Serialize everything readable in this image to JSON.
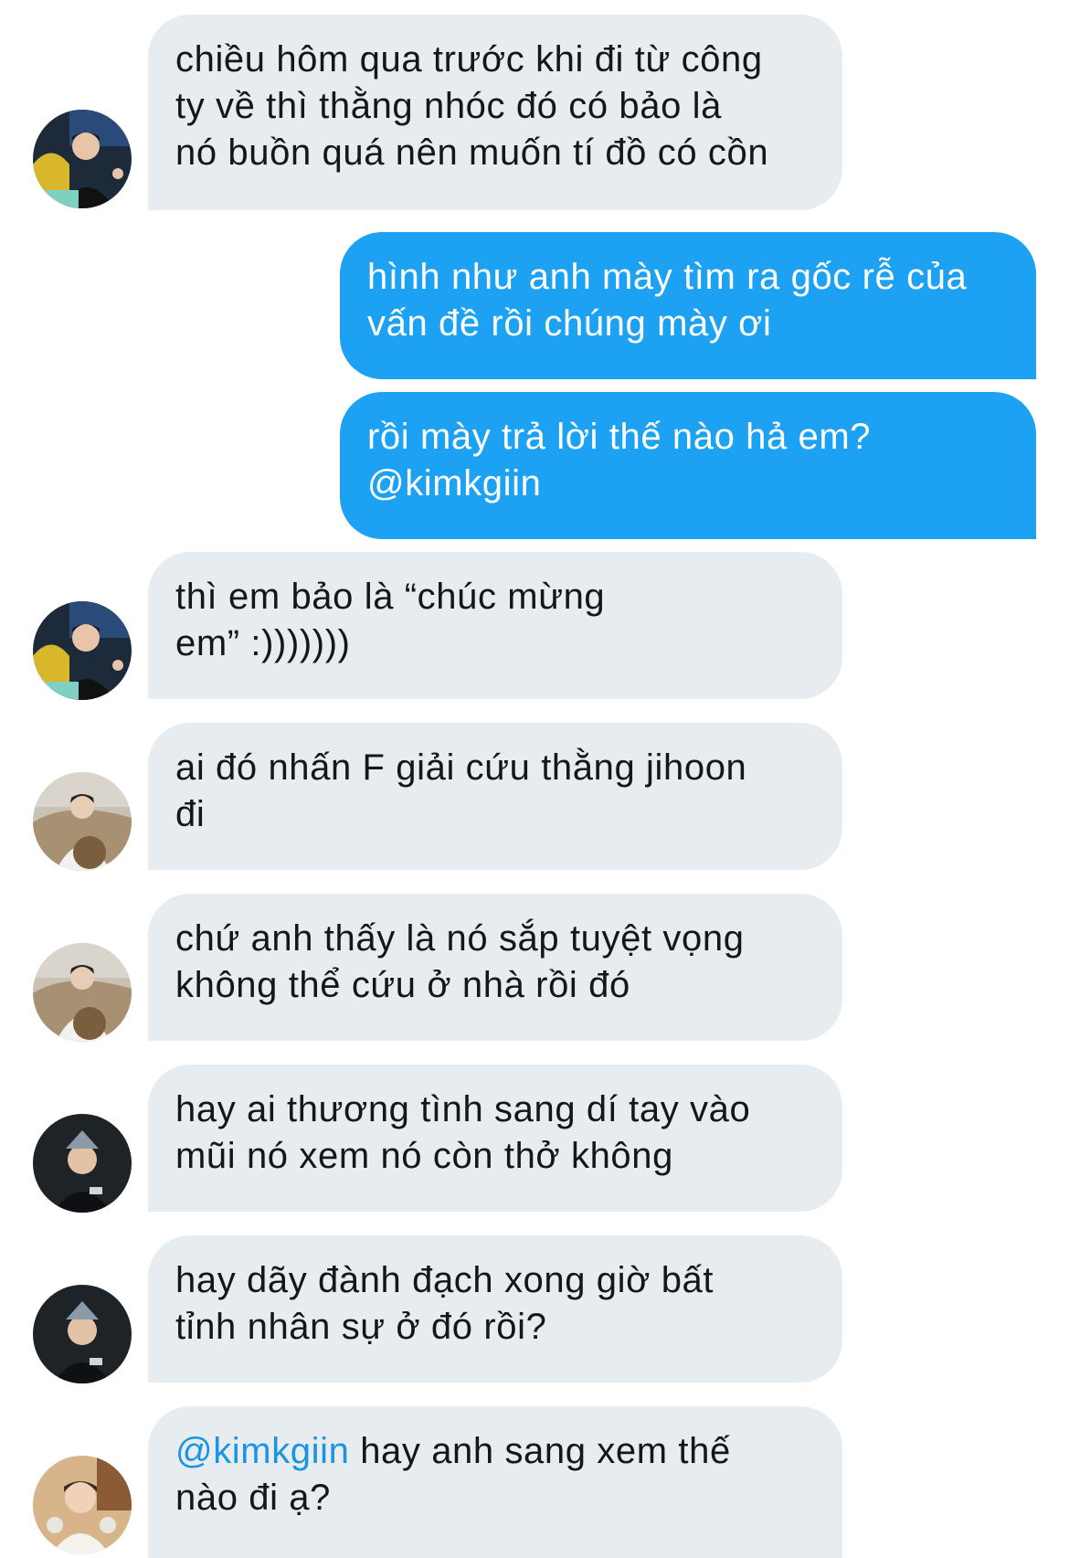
{
  "colors": {
    "incoming_bubble": "#e6ecf0",
    "outgoing_bubble": "#1da1f2",
    "mention": "#1b95e0"
  },
  "messages": [
    {
      "direction": "incoming",
      "avatar": "avatar-icon-1",
      "text": "chiều hôm qua trước khi đi từ công\nty về thì thằng nhóc đó có bảo là\nnó buồn quá nên muốn tí đồ có cồn"
    },
    {
      "direction": "outgoing",
      "text": "hình như anh mày tìm ra gốc rễ của\nvấn đề rồi chúng mày ơi"
    },
    {
      "direction": "outgoing",
      "text": "rồi mày trả lời thế nào hả em?\n@kimkgiin"
    },
    {
      "direction": "incoming",
      "avatar": "avatar-icon-1",
      "text": "thì em bảo là “chúc mừng\nem” :)))))))"
    },
    {
      "direction": "incoming",
      "avatar": "avatar-icon-2",
      "text": "ai đó nhấn F giải cứu thằng jihoon\nđi"
    },
    {
      "direction": "incoming",
      "avatar": "avatar-icon-2",
      "text": "chứ anh thấy là nó sắp tuyệt vọng\nkhông thể cứu ở nhà rồi đó"
    },
    {
      "direction": "incoming",
      "avatar": "avatar-icon-3",
      "text": "hay ai thương tình sang dí tay vào\nmũi nó xem nó còn thở không"
    },
    {
      "direction": "incoming",
      "avatar": "avatar-icon-3",
      "text": "hay dãy đành đạch xong giờ bất\ntỉnh nhân sự ở đó rồi?"
    },
    {
      "direction": "incoming",
      "avatar": "avatar-icon-4",
      "mention": "@kimkgiin",
      "text": " hay anh sang xem thế\nnào đi ạ?"
    }
  ]
}
